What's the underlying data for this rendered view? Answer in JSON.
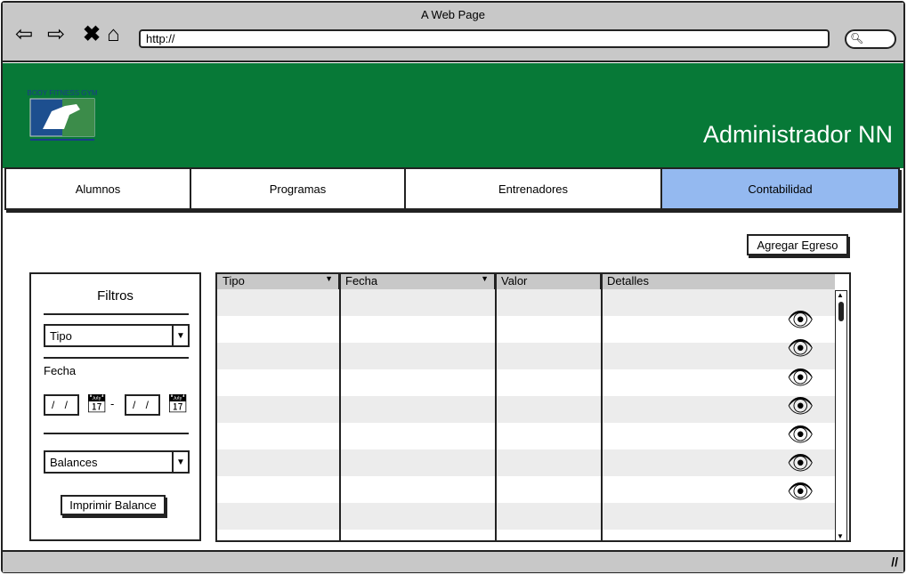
{
  "browser": {
    "title": "A Web Page",
    "url": "http://",
    "icons": [
      "back-arrow-icon",
      "forward-arrow-icon",
      "close-icon",
      "home-icon",
      "search-icon"
    ]
  },
  "header": {
    "logo_text": "BODY FITNESS GYM",
    "user": "Administrador NN",
    "color": "#077937"
  },
  "tabs": [
    {
      "label": "Alumnos"
    },
    {
      "label": "Programas"
    },
    {
      "label": "Entrenadores"
    },
    {
      "label": "Contabilidad",
      "active": true
    }
  ],
  "actions": {
    "add_expense": "Agregar Egreso"
  },
  "filters": {
    "title": "Filtros",
    "tipo": "Tipo",
    "fecha_label": "Fecha",
    "date_from": "/ /",
    "date_sep": "-",
    "date_to": "/ /",
    "balances": "Balances",
    "print": "Imprimir Balance"
  },
  "table": {
    "columns": [
      "Tipo",
      "Fecha",
      "Valor",
      "Detalles"
    ],
    "rows_with_details": 7,
    "row_count": 9
  }
}
